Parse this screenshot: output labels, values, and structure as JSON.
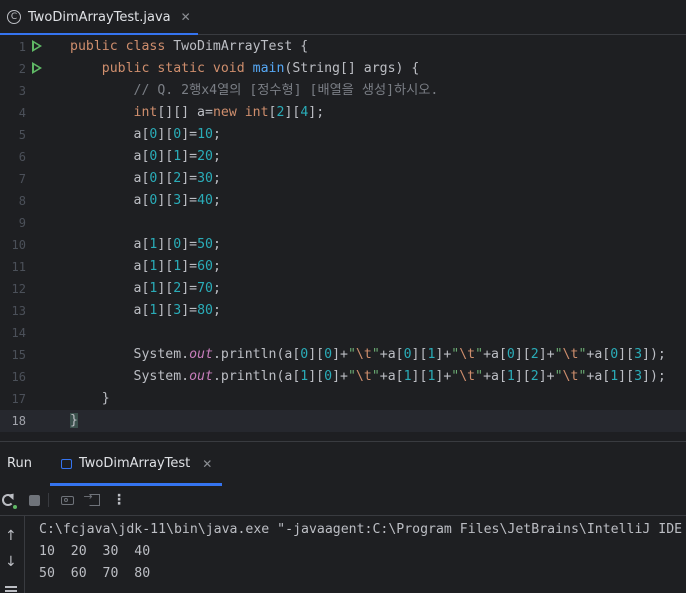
{
  "editor_tab": {
    "icon": "C",
    "title": "TwoDimArrayTest.java",
    "close": "✕"
  },
  "line_numbers": [
    "1",
    "2",
    "3",
    "4",
    "5",
    "6",
    "7",
    "8",
    "9",
    "10",
    "11",
    "12",
    "13",
    "14",
    "15",
    "16",
    "17",
    "18"
  ],
  "code": {
    "l1": {
      "kw": "public class ",
      "name": "TwoDimArrayTest ",
      "brace": "{"
    },
    "l2": {
      "kw": "public static void ",
      "method": "main",
      "rest": "(String[] args) {"
    },
    "l3": {
      "comment": "// Q. 2행x4열의 [정수형] [배열을 생성]하시오."
    },
    "l4": {
      "type": "int",
      "mid": "[][] a=",
      "new": "new ",
      "type2": "int",
      "i1": "[",
      "n1": "2",
      "i2": "][",
      "n2": "4",
      "end": "];"
    },
    "assign": [
      {
        "pre": "a[",
        "i": "0",
        "m": "][",
        "j": "0",
        "e": "]=",
        "v": "10",
        "s": ";"
      },
      {
        "pre": "a[",
        "i": "0",
        "m": "][",
        "j": "1",
        "e": "]=",
        "v": "20",
        "s": ";"
      },
      {
        "pre": "a[",
        "i": "0",
        "m": "][",
        "j": "2",
        "e": "]=",
        "v": "30",
        "s": ";"
      },
      {
        "pre": "a[",
        "i": "0",
        "m": "][",
        "j": "3",
        "e": "]=",
        "v": "40",
        "s": ";"
      },
      {
        "pre": "a[",
        "i": "1",
        "m": "][",
        "j": "0",
        "e": "]=",
        "v": "50",
        "s": ";"
      },
      {
        "pre": "a[",
        "i": "1",
        "m": "][",
        "j": "1",
        "e": "]=",
        "v": "60",
        "s": ";"
      },
      {
        "pre": "a[",
        "i": "1",
        "m": "][",
        "j": "2",
        "e": "]=",
        "v": "70",
        "s": ";"
      },
      {
        "pre": "a[",
        "i": "1",
        "m": "][",
        "j": "3",
        "e": "]=",
        "v": "80",
        "s": ";"
      }
    ],
    "println": [
      {
        "sys": "System.",
        "out": "out",
        "call": ".println(a[",
        "r": "0"
      },
      {
        "sys": "System.",
        "out": "out",
        "call": ".println(a[",
        "r": "1"
      }
    ],
    "l17": "}",
    "l18": "}"
  },
  "run_window": {
    "label": "Run",
    "tab_title": "TwoDimArrayTest",
    "tab_close": "✕",
    "command": "C:\\fcjava\\jdk-11\\bin\\java.exe \"-javaagent:C:\\Program Files\\JetBrains\\IntelliJ IDE",
    "output": [
      "10  20  30  40",
      "50  60  70  80"
    ],
    "more": "⋮",
    "up": "↑",
    "down": "↓"
  }
}
